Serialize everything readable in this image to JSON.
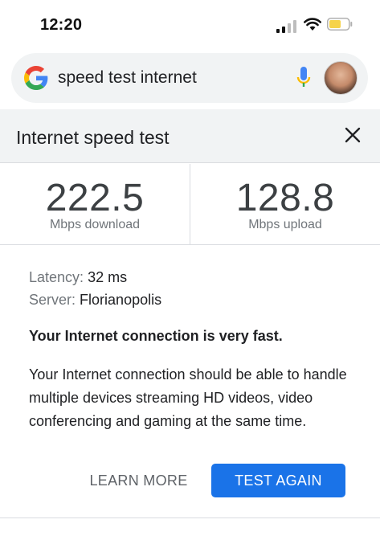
{
  "status_bar": {
    "time": "12:20"
  },
  "search": {
    "query": "speed test internet"
  },
  "card": {
    "title": "Internet speed test"
  },
  "results": {
    "download": {
      "value": "222.5",
      "unit": "Mbps download"
    },
    "upload": {
      "value": "128.8",
      "unit": "Mbps upload"
    }
  },
  "details": {
    "latency_label": "Latency:",
    "latency_value": "32 ms",
    "server_label": "Server:",
    "server_value": "Florianopolis"
  },
  "verdict": "Your Internet connection is very fast.",
  "description": "Your Internet connection should be able to handle multiple devices streaming HD videos, video conferencing and gaming at the same time.",
  "actions": {
    "learn_more": "LEARN MORE",
    "test_again": "TEST AGAIN"
  },
  "colors": {
    "accent": "#1a73e8",
    "battery": "#f6d34a"
  },
  "icons": [
    "cellular-signal-icon",
    "wifi-icon",
    "battery-icon",
    "google-logo-icon",
    "microphone-icon",
    "close-icon"
  ]
}
